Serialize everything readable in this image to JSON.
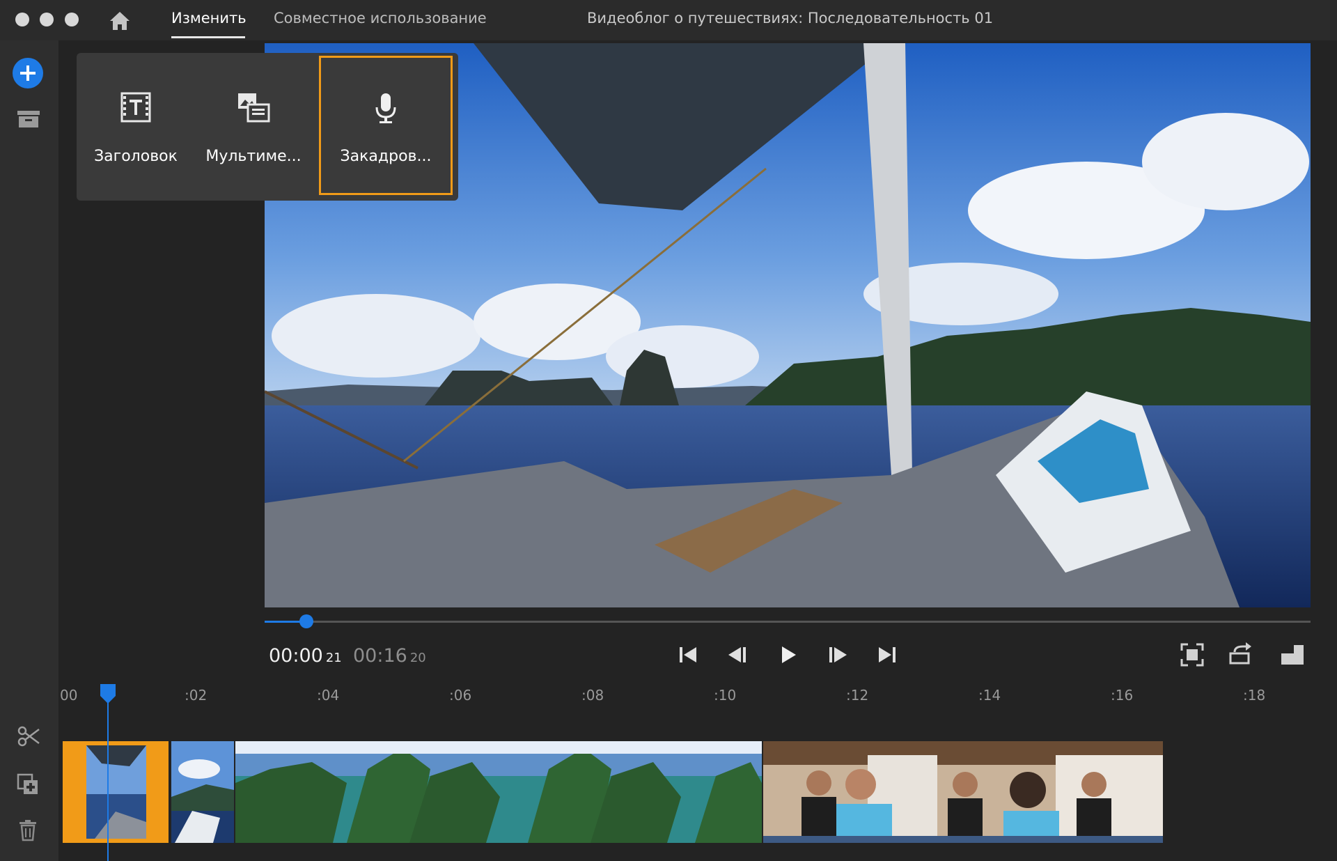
{
  "window": {
    "tabs": [
      {
        "label": "Изменить",
        "active": true
      },
      {
        "label": "Совместное использование",
        "active": false
      }
    ],
    "title": "Видеоблог о путешествиях: Последовательность 01"
  },
  "left_rail": {
    "icons": [
      "add-icon",
      "archive-icon",
      "scissors-icon",
      "duplicate-icon",
      "trash-icon"
    ]
  },
  "add_menu": {
    "options": [
      {
        "label": "Заголовок",
        "icon": "title-icon",
        "selected": false
      },
      {
        "label": "Мультиме...",
        "icon": "media-icon",
        "selected": false
      },
      {
        "label": "Закадров...",
        "icon": "microphone-icon",
        "selected": true
      }
    ]
  },
  "player": {
    "current_time": "00:00",
    "current_frames": "21",
    "total_time": "00:16",
    "total_frames": "20",
    "progress": 0.04,
    "controls": [
      "skip-to-start-icon",
      "step-back-icon",
      "play-icon",
      "step-forward-icon",
      "skip-to-end-icon"
    ],
    "right_controls": [
      "fit-frame-icon",
      "rotate-icon",
      "aspect-ratio-icon"
    ]
  },
  "timeline": {
    "ruler_labels": [
      "00",
      ":02",
      ":04",
      ":06",
      ":08",
      ":10",
      ":12",
      ":14",
      ":16",
      ":18"
    ],
    "playhead_time": "00:00:21"
  },
  "colors": {
    "accent": "#1e7be6",
    "selection": "#f19b18",
    "background": "#232323"
  }
}
